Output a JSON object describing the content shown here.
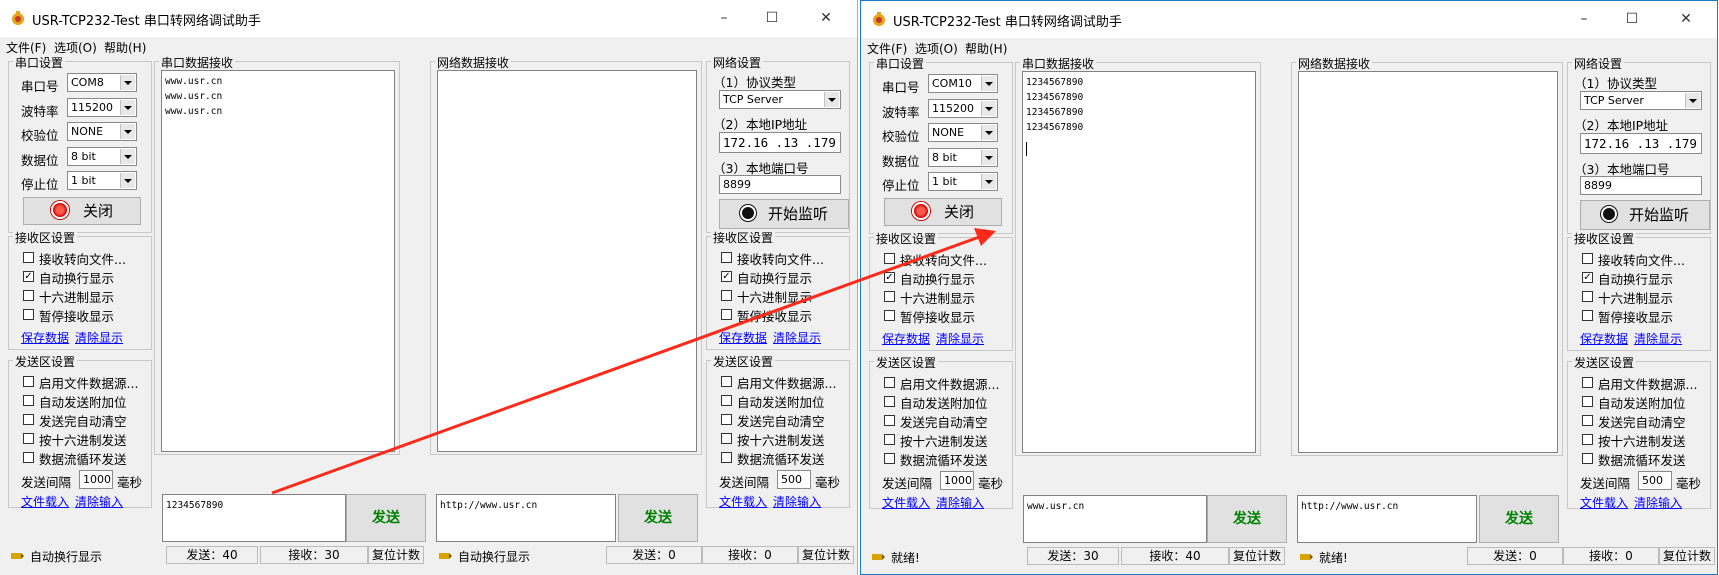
{
  "windows": [
    {
      "title": "USR-TCP232-Test 串口转网络调试助手",
      "menu": [
        "文件(F)",
        "选项(O)",
        "帮助(H)"
      ],
      "serial": {
        "group_title": "串口设置",
        "port_label": "串口号",
        "port_value": "COM8",
        "baud_label": "波特率",
        "baud_value": "115200",
        "parity_label": "校验位",
        "parity_value": "NONE",
        "data_label": "数据位",
        "data_value": "8 bit",
        "stop_label": "停止位",
        "stop_value": "1 bit",
        "toggle_label": "关闭"
      },
      "recv_settings": {
        "group_title": "接收区设置",
        "options": [
          {
            "label": "接收转向文件...",
            "checked": false
          },
          {
            "label": "自动换行显示",
            "checked": true
          },
          {
            "label": "十六进制显示",
            "checked": false
          },
          {
            "label": "暂停接收显示",
            "checked": false
          }
        ],
        "link_save": "保存数据",
        "link_clear": "清除显示"
      },
      "send_settings": {
        "group_title": "发送区设置",
        "options": [
          {
            "label": "启用文件数据源...",
            "checked": false
          },
          {
            "label": "自动发送附加位",
            "checked": false
          },
          {
            "label": "发送完自动清空",
            "checked": false
          },
          {
            "label": "按十六进制发送",
            "checked": false
          },
          {
            "label": "数据流循环发送",
            "checked": false
          }
        ],
        "interval_label": "发送间隔",
        "interval_value": "1000",
        "interval_unit": "毫秒",
        "link_load": "文件载入",
        "link_clear": "清除输入"
      },
      "serial_recv": {
        "group_title": "串口数据接收",
        "lines": [
          "www.usr.cn",
          "www.usr.cn",
          "www.usr.cn"
        ]
      },
      "net_recv": {
        "group_title": "网络数据接收",
        "lines": []
      },
      "serial_send_text": "1234567890",
      "net_send_text": "http://www.usr.cn",
      "send_label": "发送",
      "net": {
        "group_title": "网络设置",
        "proto_label": "（1）协议类型",
        "proto_value": "TCP Server",
        "ip_label": "（2）本地IP地址",
        "ip_value": "172.16 .13 .179",
        "port_label": "（3）本地端口号",
        "port_value": "8899",
        "listen_label": "开始监听"
      },
      "net_recv_settings": {
        "group_title": "接收区设置",
        "options": [
          {
            "label": "接收转向文件...",
            "checked": false
          },
          {
            "label": "自动换行显示",
            "checked": true
          },
          {
            "label": "十六进制显示",
            "checked": false
          },
          {
            "label": "暂停接收显示",
            "checked": false
          }
        ],
        "link_save": "保存数据",
        "link_clear": "清除显示"
      },
      "net_send_settings": {
        "group_title": "发送区设置",
        "options": [
          {
            "label": "启用文件数据源...",
            "checked": false
          },
          {
            "label": "自动发送附加位",
            "checked": false
          },
          {
            "label": "发送完自动清空",
            "checked": false
          },
          {
            "label": "按十六进制发送",
            "checked": false
          },
          {
            "label": "数据流循环发送",
            "checked": false
          }
        ],
        "interval_label": "发送间隔",
        "interval_value": "500",
        "interval_unit": "毫秒",
        "link_load": "文件载入",
        "link_clear": "清除输入"
      },
      "status": {
        "left_text": "自动换行显示",
        "send_count": "发送：40",
        "recv_count": "接收：30",
        "reset": "复位计数",
        "right_text": "自动换行显示",
        "net_send_count": "发送：0",
        "net_recv_count": "接收：0",
        "net_reset": "复位计数"
      }
    },
    {
      "title": "USR-TCP232-Test 串口转网络调试助手",
      "menu": [
        "文件(F)",
        "选项(O)",
        "帮助(H)"
      ],
      "serial": {
        "group_title": "串口设置",
        "port_label": "串口号",
        "port_value": "COM10",
        "baud_label": "波特率",
        "baud_value": "115200",
        "parity_label": "校验位",
        "parity_value": "NONE",
        "data_label": "数据位",
        "data_value": "8 bit",
        "stop_label": "停止位",
        "stop_value": "1 bit",
        "toggle_label": "关闭"
      },
      "recv_settings": {
        "group_title": "接收区设置",
        "options": [
          {
            "label": "接收转向文件...",
            "checked": false
          },
          {
            "label": "自动换行显示",
            "checked": true
          },
          {
            "label": "十六进制显示",
            "checked": false
          },
          {
            "label": "暂停接收显示",
            "checked": false
          }
        ],
        "link_save": "保存数据",
        "link_clear": "清除显示"
      },
      "send_settings": {
        "group_title": "发送区设置",
        "options": [
          {
            "label": "启用文件数据源...",
            "checked": false
          },
          {
            "label": "自动发送附加位",
            "checked": false
          },
          {
            "label": "发送完自动清空",
            "checked": false
          },
          {
            "label": "按十六进制发送",
            "checked": false
          },
          {
            "label": "数据流循环发送",
            "checked": false
          }
        ],
        "interval_label": "发送间隔",
        "interval_value": "1000",
        "interval_unit": "毫秒",
        "link_load": "文件载入",
        "link_clear": "清除输入"
      },
      "serial_recv": {
        "group_title": "串口数据接收",
        "lines": [
          "1234567890",
          "1234567890",
          "1234567890",
          "1234567890"
        ]
      },
      "net_recv": {
        "group_title": "网络数据接收",
        "lines": []
      },
      "serial_send_text": "www.usr.cn",
      "net_send_text": "http://www.usr.cn",
      "send_label": "发送",
      "net": {
        "group_title": "网络设置",
        "proto_label": "（1）协议类型",
        "proto_value": "TCP Server",
        "ip_label": "（2）本地IP地址",
        "ip_value": "172.16 .13 .179",
        "port_label": "（3）本地端口号",
        "port_value": "8899",
        "listen_label": "开始监听"
      },
      "net_recv_settings": {
        "group_title": "接收区设置",
        "options": [
          {
            "label": "接收转向文件...",
            "checked": false
          },
          {
            "label": "自动换行显示",
            "checked": true
          },
          {
            "label": "十六进制显示",
            "checked": false
          },
          {
            "label": "暂停接收显示",
            "checked": false
          }
        ],
        "link_save": "保存数据",
        "link_clear": "清除显示"
      },
      "net_send_settings": {
        "group_title": "发送区设置",
        "options": [
          {
            "label": "启用文件数据源...",
            "checked": false
          },
          {
            "label": "自动发送附加位",
            "checked": false
          },
          {
            "label": "发送完自动清空",
            "checked": false
          },
          {
            "label": "按十六进制发送",
            "checked": false
          },
          {
            "label": "数据流循环发送",
            "checked": false
          }
        ],
        "interval_label": "发送间隔",
        "interval_value": "500",
        "interval_unit": "毫秒",
        "link_load": "文件载入",
        "link_clear": "清除输入"
      },
      "status": {
        "left_text": "就绪!",
        "send_count": "发送：30",
        "recv_count": "接收：40",
        "reset": "复位计数",
        "right_text": "就绪!",
        "net_send_count": "发送：0",
        "net_recv_count": "接收：0",
        "net_reset": "复位计数"
      }
    }
  ],
  "colors": {
    "annotation_arrow": "#ff2a1a",
    "link": "#0000ff",
    "send_text": "#008000",
    "active_border": "#1979ca"
  }
}
